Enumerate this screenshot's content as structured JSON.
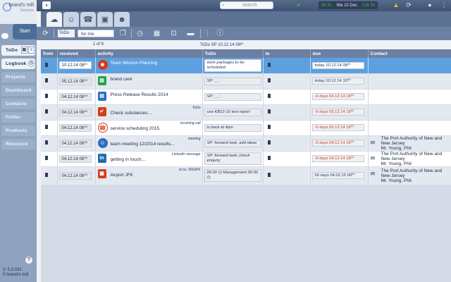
{
  "app": {
    "brand_name": "brand's mill",
    "brand_sub": "Services",
    "start_label": "Start",
    "version": "V. 5.0.031",
    "copyright": "© brand's mill"
  },
  "topbar": {
    "search_placeholder": "search",
    "date_text": "We 10 Dec",
    "clock_left": "09:30",
    "clock_right": "CW 50"
  },
  "sidebar": {
    "items": [
      {
        "label": "ToDo",
        "active": true
      },
      {
        "label": "Logbook",
        "active": false
      },
      {
        "label": "Projects",
        "active": false
      },
      {
        "label": "Dashboard",
        "active": false
      },
      {
        "label": "Contacts",
        "active": false
      },
      {
        "label": "Folder",
        "active": false
      },
      {
        "label": "Products",
        "active": false
      },
      {
        "label": "Resource",
        "active": false
      }
    ]
  },
  "toolbar": {
    "todo_select": "ToDo",
    "filter_select": "for me"
  },
  "info": {
    "page_info": "1 of 8",
    "list_title": "ToDo SP 10.12.14 08²⁰"
  },
  "table": {
    "columns": [
      "from",
      "received",
      "activity",
      "ToDo",
      "to",
      "due",
      "Contact"
    ],
    "rows": [
      {
        "received": "10.12.14 08²⁰",
        "activity": "Team Mission Planning",
        "type": "",
        "todo": "work packages to be scheduled",
        "due": "today 10.12.14 08²⁰",
        "due_late": false,
        "contact": "",
        "selected": true,
        "icon": "people",
        "icon_color": "#d43c1c"
      },
      {
        "received": "05.12.14 08⁰⁰",
        "activity": "brand care",
        "type": "",
        "todo": "SP: __:",
        "due": "today 10.12.14 15⁰⁰",
        "due_late": false,
        "contact": "",
        "selected": false,
        "icon": "doc",
        "icon_color": "#2aa14a"
      },
      {
        "received": "04.12.14 08⁰⁰",
        "activity": "Press Release Results 2014",
        "type": "",
        "todo": "SP: __:",
        "due": "-6 days 04.12.14 18⁰⁰",
        "due_late": true,
        "contact": "",
        "selected": false,
        "icon": "doc",
        "icon_color": "#2b6cc4"
      },
      {
        "received": "04.12.14 08⁰⁰",
        "activity": "Check substances...",
        "type": "ToDo",
        "todo": "use KB12-16 test report",
        "due": "-5 days 05.12.14 18⁰⁰",
        "due_late": true,
        "contact": "",
        "selected": false,
        "icon": "check",
        "icon_color": "#d43c1c"
      },
      {
        "received": "04.12.14 08⁰⁰",
        "activity": "service scheduling 2015",
        "type": "incoming call",
        "todo": "is back at 4pm",
        "due": "-5 days 05.12.14 18⁰⁰",
        "due_late": true,
        "contact": "",
        "selected": false,
        "icon": "phone",
        "icon_color": "#ffffff"
      },
      {
        "received": "04.12.14 08⁰⁰",
        "activity": "team meeting 12/2014 results...",
        "type": "meeting",
        "todo": "SP: forward task, add ideas",
        "due": "-6 days 04.12.14 18⁰⁰",
        "due_late": true,
        "contact": "The Port Authority of New and New Jersey\nMr. Young, Phil",
        "selected": false,
        "icon": "meeting",
        "icon_color": "#2b6cc4"
      },
      {
        "received": "04.12.14 08⁰⁰",
        "activity": "getting in touch...",
        "type": "LinkedIn message",
        "todo": "SP: forward task; check enquiry",
        "due": "-6 days 04.12.14 18⁰⁰",
        "due_late": true,
        "contact": "The Port Authority of New and New Jersey\nMr. Young, Phil",
        "selected": false,
        "icon": "linkedin",
        "icon_color": "#1a6fae"
      },
      {
        "received": "04.12.14 08⁰⁰",
        "activity": "Airport JFK",
        "type": "vt.no. 999JFK",
        "todo": "06:00 ◷ Management 06:00 ◷",
        "due": "56 days 04.02.15 00⁰⁰",
        "due_late": false,
        "contact": "The Port Authority of New and New Jersey\nMr. Young, Phil",
        "selected": false,
        "icon": "calendar",
        "icon_color": "#d43c1c"
      }
    ]
  }
}
